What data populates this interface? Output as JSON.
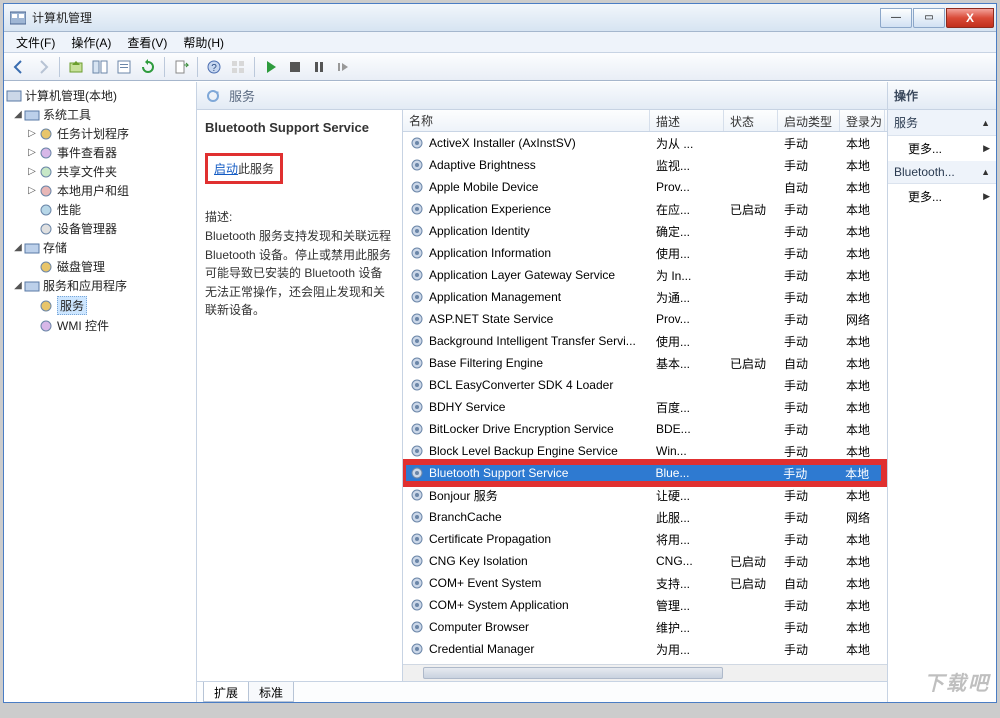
{
  "window": {
    "title": "计算机管理"
  },
  "win_buttons": {
    "minimize": "—",
    "maximize": "▭",
    "close": "X"
  },
  "menus": {
    "file": "文件(F)",
    "action": "操作(A)",
    "view": "查看(V)",
    "help": "帮助(H)"
  },
  "tree": {
    "root": "计算机管理(本地)",
    "groups": [
      {
        "label": "系统工具",
        "children": [
          {
            "label": "任务计划程序"
          },
          {
            "label": "事件查看器"
          },
          {
            "label": "共享文件夹"
          },
          {
            "label": "本地用户和组"
          },
          {
            "label": "性能"
          },
          {
            "label": "设备管理器"
          }
        ]
      },
      {
        "label": "存储",
        "children": [
          {
            "label": "磁盘管理"
          }
        ]
      },
      {
        "label": "服务和应用程序",
        "children": [
          {
            "label": "服务",
            "selected": true
          },
          {
            "label": "WMI 控件"
          }
        ]
      }
    ]
  },
  "center": {
    "header_title": "服务",
    "detail": {
      "service_name": "Bluetooth Support Service",
      "start_link": "启动",
      "start_suffix": "此服务",
      "desc_label": "描述:",
      "desc_text": "Bluetooth 服务支持发现和关联远程 Bluetooth 设备。停止或禁用此服务可能导致已安装的 Bluetooth 设备无法正常操作，还会阻止发现和关联新设备。"
    },
    "columns": {
      "name": "名称",
      "desc": "描述",
      "status": "状态",
      "startup": "启动类型",
      "logon": "登录为"
    },
    "tabs": {
      "ext": "扩展",
      "std": "标准"
    }
  },
  "services": [
    {
      "name": "ActiveX Installer (AxInstSV)",
      "desc": "为从 ...",
      "status": "",
      "startup": "手动",
      "logon": "本地"
    },
    {
      "name": "Adaptive Brightness",
      "desc": "监视...",
      "status": "",
      "startup": "手动",
      "logon": "本地"
    },
    {
      "name": "Apple Mobile Device",
      "desc": "Prov...",
      "status": "",
      "startup": "自动",
      "logon": "本地"
    },
    {
      "name": "Application Experience",
      "desc": "在应...",
      "status": "已启动",
      "startup": "手动",
      "logon": "本地"
    },
    {
      "name": "Application Identity",
      "desc": "确定...",
      "status": "",
      "startup": "手动",
      "logon": "本地"
    },
    {
      "name": "Application Information",
      "desc": "使用...",
      "status": "",
      "startup": "手动",
      "logon": "本地"
    },
    {
      "name": "Application Layer Gateway Service",
      "desc": "为 In...",
      "status": "",
      "startup": "手动",
      "logon": "本地"
    },
    {
      "name": "Application Management",
      "desc": "为通...",
      "status": "",
      "startup": "手动",
      "logon": "本地"
    },
    {
      "name": "ASP.NET State Service",
      "desc": "Prov...",
      "status": "",
      "startup": "手动",
      "logon": "网络"
    },
    {
      "name": "Background Intelligent Transfer Servi...",
      "desc": "使用...",
      "status": "",
      "startup": "手动",
      "logon": "本地"
    },
    {
      "name": "Base Filtering Engine",
      "desc": "基本...",
      "status": "已启动",
      "startup": "自动",
      "logon": "本地"
    },
    {
      "name": "BCL EasyConverter SDK 4 Loader",
      "desc": "",
      "status": "",
      "startup": "手动",
      "logon": "本地"
    },
    {
      "name": "BDHY Service",
      "desc": "百度...",
      "status": "",
      "startup": "手动",
      "logon": "本地"
    },
    {
      "name": "BitLocker Drive Encryption Service",
      "desc": "BDE...",
      "status": "",
      "startup": "手动",
      "logon": "本地"
    },
    {
      "name": "Block Level Backup Engine Service",
      "desc": "Win...",
      "status": "",
      "startup": "手动",
      "logon": "本地"
    },
    {
      "name": "Bluetooth Support Service",
      "desc": "Blue...",
      "status": "",
      "startup": "手动",
      "logon": "本地",
      "selected": true
    },
    {
      "name": "Bonjour 服务",
      "desc": "让硬...",
      "status": "",
      "startup": "手动",
      "logon": "本地"
    },
    {
      "name": "BranchCache",
      "desc": "此服...",
      "status": "",
      "startup": "手动",
      "logon": "网络"
    },
    {
      "name": "Certificate Propagation",
      "desc": "将用...",
      "status": "",
      "startup": "手动",
      "logon": "本地"
    },
    {
      "name": "CNG Key Isolation",
      "desc": "CNG...",
      "status": "已启动",
      "startup": "手动",
      "logon": "本地"
    },
    {
      "name": "COM+ Event System",
      "desc": "支持...",
      "status": "已启动",
      "startup": "自动",
      "logon": "本地"
    },
    {
      "name": "COM+ System Application",
      "desc": "管理...",
      "status": "",
      "startup": "手动",
      "logon": "本地"
    },
    {
      "name": "Computer Browser",
      "desc": "维护...",
      "status": "",
      "startup": "手动",
      "logon": "本地"
    },
    {
      "name": "Credential Manager",
      "desc": "为用...",
      "status": "",
      "startup": "手动",
      "logon": "本地"
    }
  ],
  "actions": {
    "header": "操作",
    "section1": "服务",
    "more": "更多...",
    "section2": "Bluetooth..."
  },
  "watermark": "下载吧"
}
